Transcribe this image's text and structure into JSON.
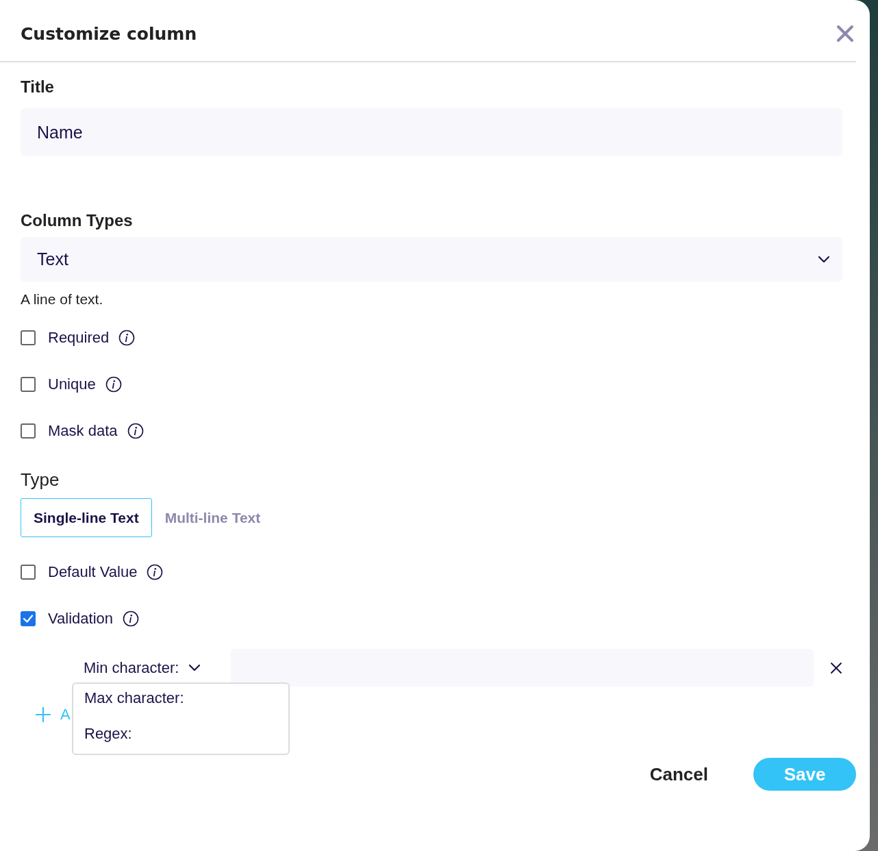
{
  "dialog": {
    "title": "Customize column"
  },
  "title_field": {
    "label": "Title",
    "value": "Name"
  },
  "column_type": {
    "label": "Column Types",
    "value": "Text",
    "description": "A line of text."
  },
  "options": [
    {
      "kind": "checkbox",
      "label": "Required",
      "checked": false
    },
    {
      "kind": "checkbox",
      "label": "Unique",
      "checked": false
    },
    {
      "kind": "checkbox",
      "label": "Mask data",
      "checked": false
    },
    {
      "kind": "segmented",
      "label": "Type",
      "segments": [
        {
          "label": "Single-line Text",
          "selected": true
        },
        {
          "label": "Multi-line Text",
          "selected": false
        }
      ]
    },
    {
      "kind": "checkbox",
      "label": "Default Value",
      "checked": false
    },
    {
      "kind": "checkbox",
      "label": "Validation",
      "checked": true
    }
  ],
  "validation": {
    "selector": "Min character:",
    "expanded": true,
    "menu": [
      "Max character:",
      "Regex:"
    ],
    "add_link": "A"
  },
  "buttons": [
    {
      "kind": "secondary",
      "label": "Cancel"
    },
    {
      "kind": "primary",
      "label": "Save"
    }
  ]
}
